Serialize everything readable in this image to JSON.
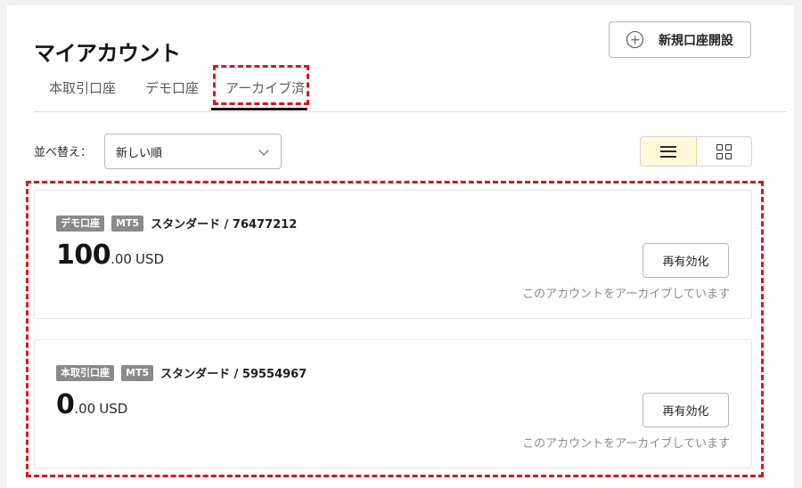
{
  "header": {
    "title": "マイアカウント",
    "new_account_label": "新規口座開設"
  },
  "tabs": [
    {
      "label": "本取引口座",
      "active": false
    },
    {
      "label": "デモ口座",
      "active": false
    },
    {
      "label": "アーカイブ済",
      "active": true
    }
  ],
  "sort": {
    "label": "並べ替え：",
    "selected": "新しい順"
  },
  "view_mode": "list",
  "accounts": [
    {
      "type_badge": "デモ口座",
      "platform_badge": "MT5",
      "name": "スタンダード / 76477212",
      "balance_int": "100",
      "balance_dec": ".00",
      "currency": "USD",
      "action_label": "再有効化",
      "status_note": "このアカウントをアーカイブしています"
    },
    {
      "type_badge": "本取引口座",
      "platform_badge": "MT5",
      "name": "スタンダード / 59554967",
      "balance_int": "0",
      "balance_dec": ".00",
      "currency": "USD",
      "action_label": "再有効化",
      "status_note": "このアカウントをアーカイブしています"
    }
  ],
  "colors": {
    "highlight": "#e0151b",
    "badge": "#8a8a8e",
    "active_view": "#fff8d9"
  }
}
